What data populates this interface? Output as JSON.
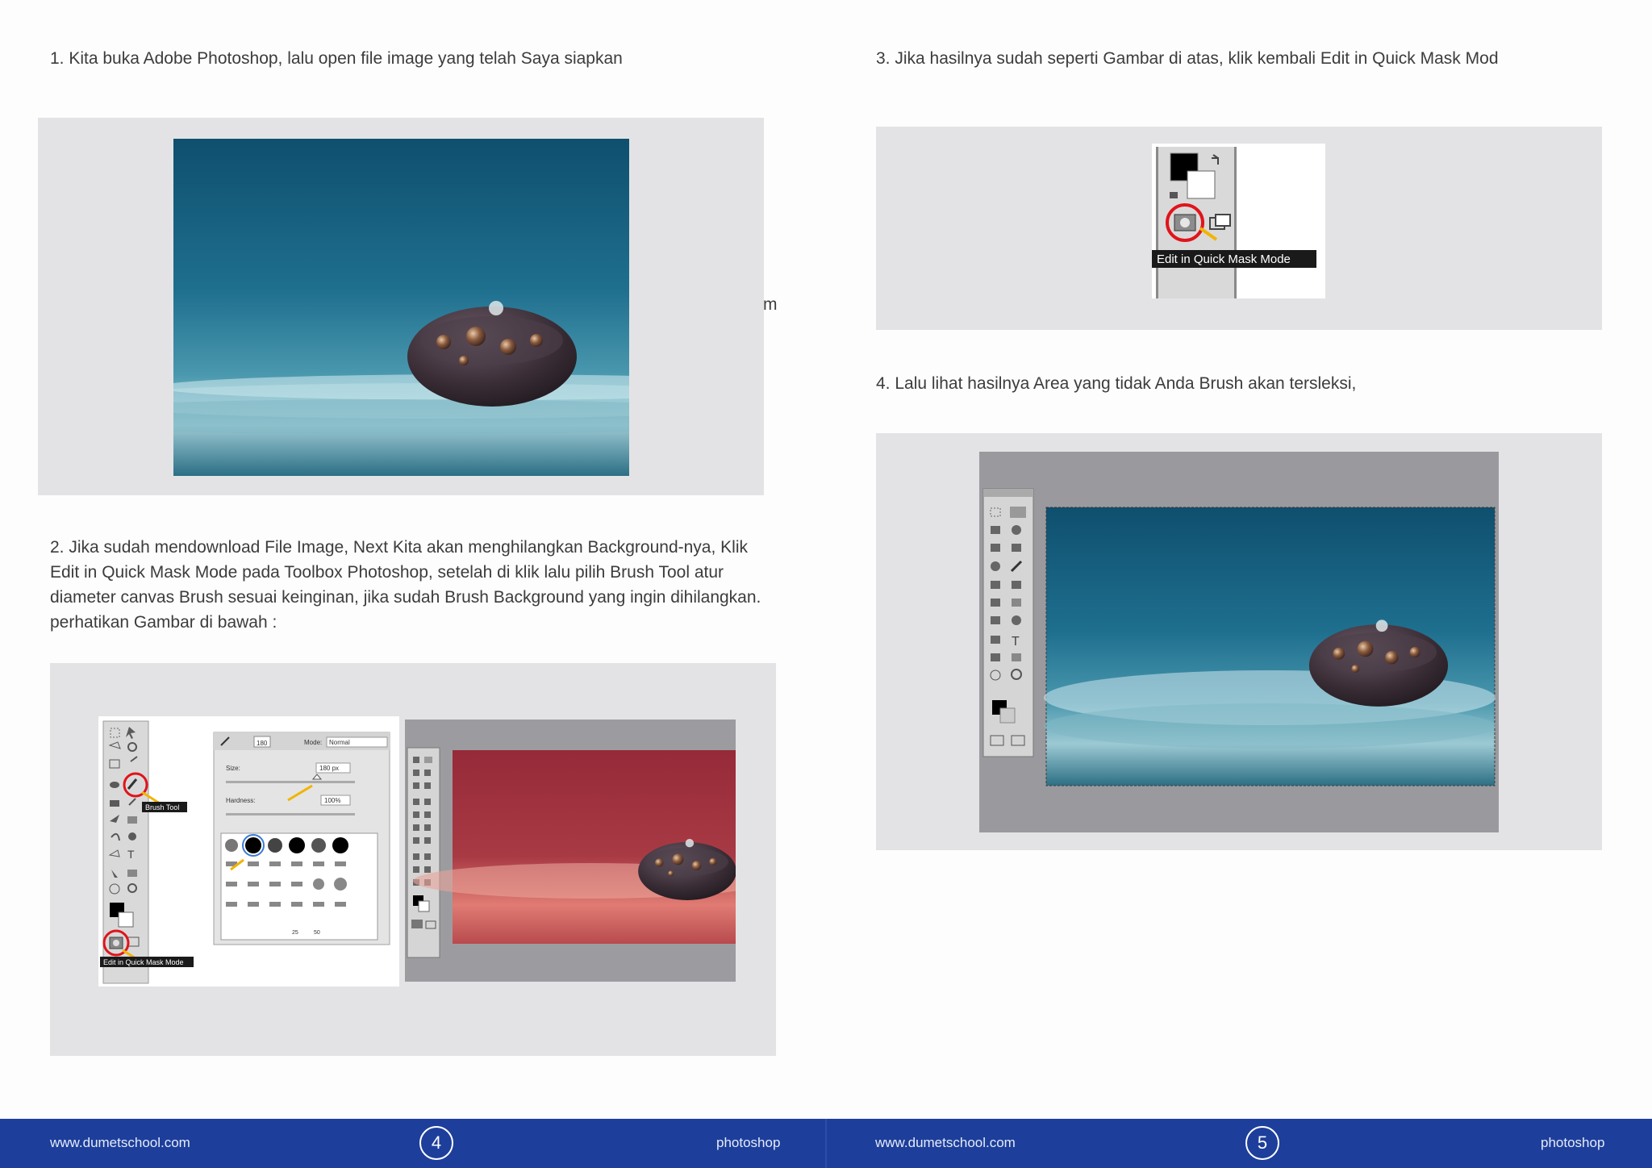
{
  "pages": [
    {
      "step1": "1. Kita buka Adobe Photoshop, lalu open file image yang telah Saya siapkan",
      "stray_char": "m",
      "step2": "2. Jika sudah mendownload File Image, Next Kita akan menghilangkan Background-nya, Klik Edit in Quick Mask Mode pada Toolbox Photoshop, setelah di klik lalu pilih Brush Tool atur diameter canvas Brush sesuai keinginan, jika sudah Brush Background yang ingin dihilangkan. perhatikan Gambar di bawah :",
      "tooltip_brush": "Brush Tool",
      "tooltip_mask": "Edit in Quick Mask Mode",
      "brush_panel": {
        "size_label": "Size:",
        "size_value": "180 px",
        "hardness_label": "Hardness:",
        "hardness_value": "100%",
        "mode_label": "Mode:",
        "mode_value": "Normal",
        "brush_size_top": "180",
        "preset_labels": [
          "25",
          "50"
        ]
      },
      "footer": {
        "site": "www.dumetschool.com",
        "page_number": "4",
        "tag": "photoshop"
      }
    },
    {
      "step3": "3. Jika hasilnya sudah seperti Gambar di atas, klik kembali Edit in Quick Mask Mod",
      "tooltip_mask": "Edit in Quick Mask Mode",
      "step4": "4. Lalu lihat hasilnya Area yang tidak Anda Brush akan tersleksi,",
      "footer": {
        "site": "www.dumetschool.com",
        "page_number": "5",
        "tag": "photoshop"
      }
    }
  ],
  "colors": {
    "footer_bg": "#1d3f9b",
    "panel_bg": "#e3e3e5",
    "highlight_circle": "#e0141b",
    "arrow": "#f2b400"
  }
}
